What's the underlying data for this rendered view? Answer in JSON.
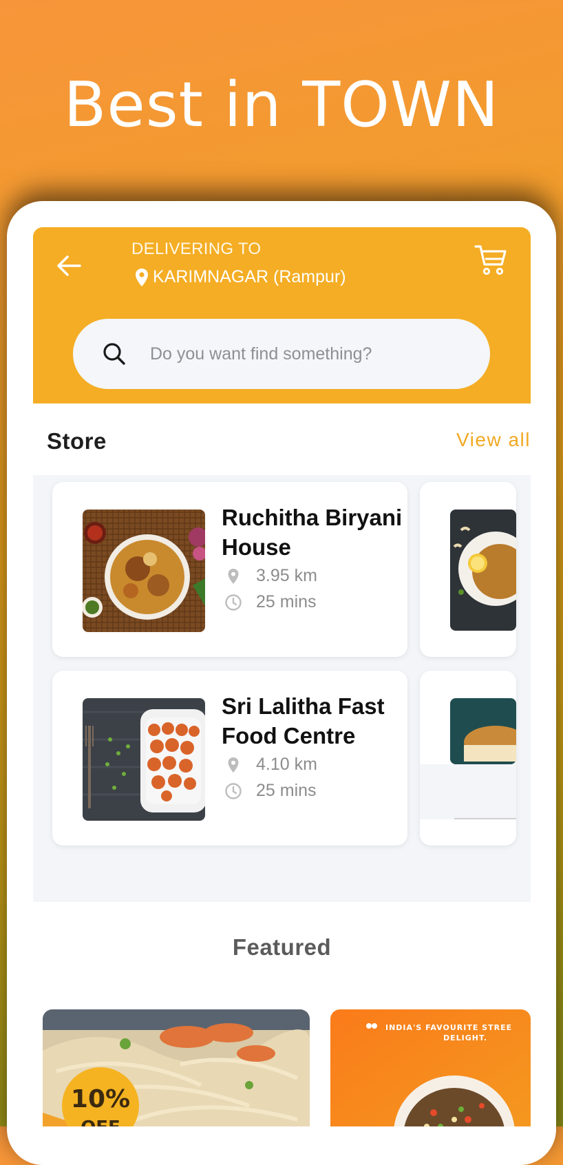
{
  "promo": {
    "headline": "Best in TOWN"
  },
  "header": {
    "delivering_label": "DELIVERING TO",
    "location": "KARIMNAGAR (Rampur)"
  },
  "search": {
    "placeholder": "Do you want find something?"
  },
  "store_section": {
    "title": "Store",
    "view_all": "View all"
  },
  "stores": [
    {
      "name": "Ruchitha Biryani House",
      "distance": "3.95 km",
      "time": "25 mins"
    },
    {
      "name": "Sri Lalitha Fast Food Centre",
      "distance": "4.10 km",
      "time": "25 mins"
    }
  ],
  "featured": {
    "title": "Featured",
    "banners": [
      {
        "badge_line1": "10%",
        "badge_line2": "OFF"
      },
      {
        "tagline_line1": "INDIA'S FAVOURITE STREE",
        "tagline_line2": "DELIGHT."
      }
    ]
  },
  "colors": {
    "accent": "#f4ad24",
    "view_all": "#f0a922"
  }
}
